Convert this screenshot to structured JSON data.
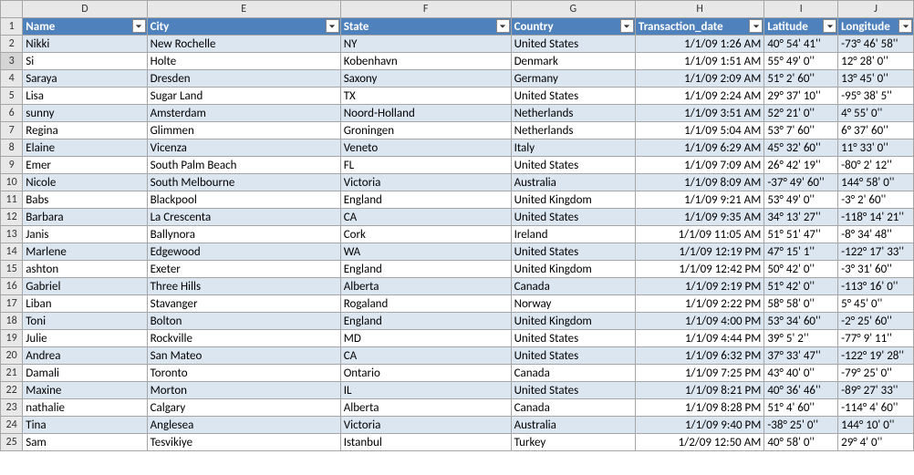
{
  "columns": [
    "D",
    "E",
    "F",
    "G",
    "H",
    "I",
    "J"
  ],
  "headers": {
    "D": "Name",
    "E": "City",
    "F": "State",
    "G": "Country",
    "H": "Transaction_date",
    "I": "Latitude",
    "J": "Longitude"
  },
  "rowStart": 1,
  "rows": [
    {
      "n": 2,
      "Name": "Nikki",
      "City": "New Rochelle",
      "State": "NY",
      "Country": "United States",
      "Transaction_date": "1/1/09 1:26 AM",
      "Latitude": "40° 54'  41''",
      "Longitude": "-73° 46'  58''"
    },
    {
      "n": 3,
      "Name": "Si",
      "City": "Holte",
      "State": "Kobenhavn",
      "Country": "Denmark",
      "Transaction_date": "1/1/09 1:51 AM",
      "Latitude": "55° 49'  0''",
      "Longitude": "12° 28'  0''"
    },
    {
      "n": 4,
      "Name": "Saraya",
      "City": "Dresden",
      "State": "Saxony",
      "Country": "Germany",
      "Transaction_date": "1/1/09 2:09 AM",
      "Latitude": "51° 2'  60''",
      "Longitude": "13° 45'  0''"
    },
    {
      "n": 5,
      "Name": "Lisa",
      "City": "Sugar Land",
      "State": "TX",
      "Country": "United States",
      "Transaction_date": "1/1/09 2:24 AM",
      "Latitude": "29° 37'  10''",
      "Longitude": "-95° 38'  5''"
    },
    {
      "n": 6,
      "Name": "sunny",
      "City": "Amsterdam",
      "State": "Noord-Holland",
      "Country": "Netherlands",
      "Transaction_date": "1/1/09 3:51 AM",
      "Latitude": "52° 21'  0''",
      "Longitude": "4° 55'  0''"
    },
    {
      "n": 7,
      "Name": "Regina",
      "City": "Glimmen",
      "State": "Groningen",
      "Country": "Netherlands",
      "Transaction_date": "1/1/09 5:04 AM",
      "Latitude": "53° 7'  60''",
      "Longitude": "6° 37'  60''"
    },
    {
      "n": 8,
      "Name": "Elaine",
      "City": "Vicenza",
      "State": "Veneto",
      "Country": "Italy",
      "Transaction_date": "1/1/09 6:29 AM",
      "Latitude": "45° 32'  60''",
      "Longitude": "11° 33'  0''"
    },
    {
      "n": 9,
      "Name": "Emer",
      "City": "South Palm Beach",
      "State": "FL",
      "Country": "United States",
      "Transaction_date": "1/1/09 7:09 AM",
      "Latitude": "26° 42'  19''",
      "Longitude": "-80° 2'  12''"
    },
    {
      "n": 10,
      "Name": "Nicole",
      "City": "South Melbourne",
      "State": "Victoria",
      "Country": "Australia",
      "Transaction_date": "1/1/09 8:09 AM",
      "Latitude": "-37° 49'  60''",
      "Longitude": "144° 58'  0''"
    },
    {
      "n": 11,
      "Name": "Babs",
      "City": "Blackpool",
      "State": "England",
      "Country": "United Kingdom",
      "Transaction_date": "1/1/09 9:21 AM",
      "Latitude": "53° 49'  0''",
      "Longitude": "-3° 2'  60''"
    },
    {
      "n": 12,
      "Name": "Barbara",
      "City": "La Crescenta",
      "State": "CA",
      "Country": "United States",
      "Transaction_date": "1/1/09 9:35 AM",
      "Latitude": "34° 13'  27''",
      "Longitude": "-118° 14'  21''"
    },
    {
      "n": 13,
      "Name": "Janis",
      "City": "Ballynora",
      "State": "Cork",
      "Country": "Ireland",
      "Transaction_date": "1/1/09 11:05 AM",
      "Latitude": "51° 51'  47''",
      "Longitude": "-8° 34'  48''"
    },
    {
      "n": 14,
      "Name": "Marlene",
      "City": "Edgewood",
      "State": "WA",
      "Country": "United States",
      "Transaction_date": "1/1/09 12:19 PM",
      "Latitude": "47° 15'  1''",
      "Longitude": "-122° 17'  33''"
    },
    {
      "n": 15,
      "Name": "ashton",
      "City": "Exeter",
      "State": "England",
      "Country": "United Kingdom",
      "Transaction_date": "1/1/09 12:42 PM",
      "Latitude": "50° 42'  0''",
      "Longitude": "-3° 31'  60''"
    },
    {
      "n": 16,
      "Name": "Gabriel",
      "City": "Three Hills",
      "State": "Alberta",
      "Country": "Canada",
      "Transaction_date": "1/1/09 2:19 PM",
      "Latitude": "51° 42'  0''",
      "Longitude": "-113° 16'  0''"
    },
    {
      "n": 17,
      "Name": "Liban",
      "City": "Stavanger",
      "State": "Rogaland",
      "Country": "Norway",
      "Transaction_date": "1/1/09 2:22 PM",
      "Latitude": "58° 58'  0''",
      "Longitude": "5° 45'  0''"
    },
    {
      "n": 18,
      "Name": "Toni",
      "City": "Bolton",
      "State": "England",
      "Country": "United Kingdom",
      "Transaction_date": "1/1/09 4:00 PM",
      "Latitude": "53° 34'  60''",
      "Longitude": "-2° 25'  60''"
    },
    {
      "n": 19,
      "Name": "Julie",
      "City": "Rockville",
      "State": "MD",
      "Country": "United States",
      "Transaction_date": "1/1/09 4:44 PM",
      "Latitude": "39° 5'  2''",
      "Longitude": "-77° 9'  11''"
    },
    {
      "n": 20,
      "Name": "Andrea",
      "City": "San Mateo",
      "State": "CA",
      "Country": "United States",
      "Transaction_date": "1/1/09 6:32 PM",
      "Latitude": "37° 33'  47''",
      "Longitude": "-122° 19'  28''"
    },
    {
      "n": 21,
      "Name": "Damali",
      "City": "Toronto",
      "State": "Ontario",
      "Country": "Canada",
      "Transaction_date": "1/1/09 7:25 PM",
      "Latitude": "43° 40'  0''",
      "Longitude": "-79° 25'  0''"
    },
    {
      "n": 22,
      "Name": "Maxine",
      "City": "Morton",
      "State": "IL",
      "Country": "United States",
      "Transaction_date": "1/1/09 8:21 PM",
      "Latitude": "40° 36'  46''",
      "Longitude": "-89° 27'  33''"
    },
    {
      "n": 23,
      "Name": "nathalie",
      "City": "Calgary",
      "State": "Alberta",
      "Country": "Canada",
      "Transaction_date": "1/1/09 8:28 PM",
      "Latitude": "51° 4'  60''",
      "Longitude": "-114° 4'  60''"
    },
    {
      "n": 24,
      "Name": "Tina",
      "City": "Anglesea",
      "State": "Victoria",
      "Country": "Australia",
      "Transaction_date": "1/1/09 9:40 PM",
      "Latitude": "-38° 25'  0''",
      "Longitude": "144° 10'  0''"
    },
    {
      "n": 25,
      "Name": "Sam",
      "City": "Tesvikiye",
      "State": "Istanbul",
      "Country": "Turkey",
      "Transaction_date": "1/2/09 12:50 AM",
      "Latitude": "40° 58'  0''",
      "Longitude": "29° 4'  0''"
    }
  ],
  "selectedRow": 3
}
